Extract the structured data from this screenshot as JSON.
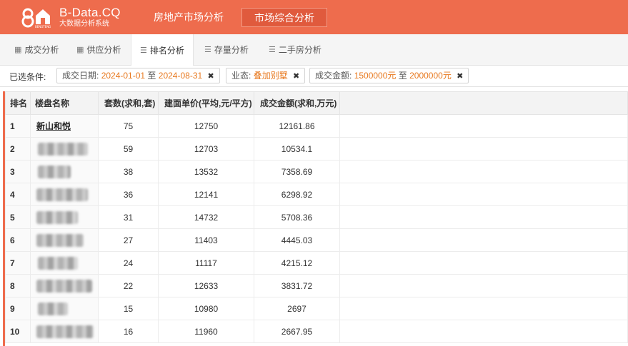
{
  "header": {
    "brand_name": "B-Data.CQ",
    "brand_sub": "大数据分析系统",
    "logo_small_text": "BENGTENG",
    "nav": [
      "房地产市场分析",
      "市场综合分析"
    ]
  },
  "subtabs": [
    {
      "label": "成交分析",
      "icon": "grid-icon"
    },
    {
      "label": "供应分析",
      "icon": "grid-icon"
    },
    {
      "label": "排名分析",
      "icon": "list-icon"
    },
    {
      "label": "存量分析",
      "icon": "list-icon"
    },
    {
      "label": "二手房分析",
      "icon": "list-icon"
    }
  ],
  "filters": {
    "label": "已选条件:",
    "date": {
      "key": "成交日期:",
      "from": "2024-01-01",
      "sep": "至",
      "to": "2024-08-31"
    },
    "type": {
      "key": "业态:",
      "value": "叠加别墅"
    },
    "amount": {
      "key": "成交金额:",
      "from": "1500000元",
      "sep": "至",
      "to": "2000000元"
    },
    "remove": "✖"
  },
  "table": {
    "headers": [
      "排名",
      "楼盘名称",
      "套数(求和,套)",
      "建面单价(平均,元/平方)",
      "成交金额(求和,万元)"
    ],
    "rows": [
      {
        "rank": "1",
        "name": "新山和悦",
        "count": "75",
        "price": "12750",
        "amount": "12161.86"
      },
      {
        "rank": "2",
        "name": "",
        "count": "59",
        "price": "12703",
        "amount": "10534.1"
      },
      {
        "rank": "3",
        "name": "",
        "count": "38",
        "price": "13532",
        "amount": "7358.69"
      },
      {
        "rank": "4",
        "name": "",
        "count": "36",
        "price": "12141",
        "amount": "6298.92"
      },
      {
        "rank": "5",
        "name": "",
        "count": "31",
        "price": "14732",
        "amount": "5708.36"
      },
      {
        "rank": "6",
        "name": "",
        "count": "27",
        "price": "11403",
        "amount": "4445.03"
      },
      {
        "rank": "7",
        "name": "",
        "count": "24",
        "price": "11117",
        "amount": "4215.12"
      },
      {
        "rank": "8",
        "name": "",
        "count": "22",
        "price": "12633",
        "amount": "3831.72"
      },
      {
        "rank": "9",
        "name": "",
        "count": "15",
        "price": "10980",
        "amount": "2697"
      },
      {
        "rank": "10",
        "name": "",
        "count": "16",
        "price": "11960",
        "amount": "2667.95"
      }
    ]
  },
  "colors": {
    "brand": "#ee6c4d",
    "active_nav": "#e05a3d",
    "filter_value": "#e8791f"
  }
}
